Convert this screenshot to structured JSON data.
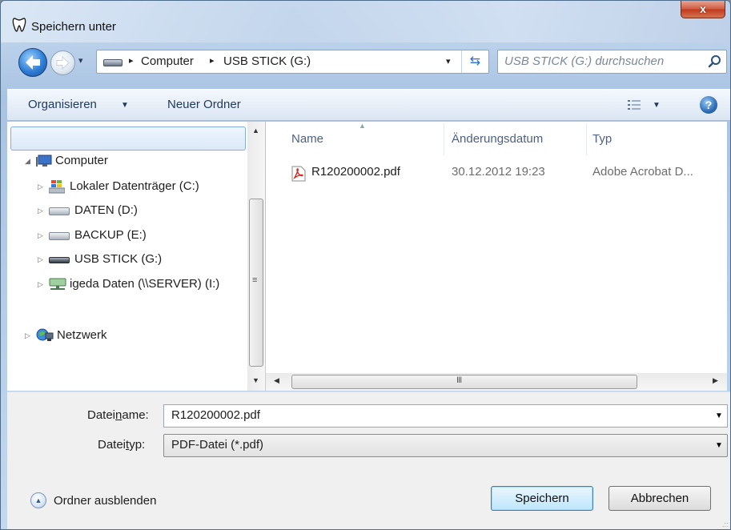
{
  "window": {
    "title": "Speichern unter",
    "close_label": "x"
  },
  "address_bar": {
    "separator": "▸",
    "segments": [
      "Computer",
      "USB STICK (G:)"
    ],
    "dropdown_glyph": "▾",
    "refresh_glyph": "⇆"
  },
  "search": {
    "placeholder": "USB STICK (G:) durchsuchen"
  },
  "toolbar": {
    "organize_label": "Organisieren",
    "dropdown_glyph": "▼",
    "new_folder_label": "Neuer Ordner",
    "help_label": "?"
  },
  "nav_tree": {
    "expander_open": "◢",
    "expander_closed": "▷",
    "items": [
      {
        "label": "Computer",
        "icon": "computer-icon",
        "expanded": true
      },
      {
        "label": "Lokaler Datenträger (C:)",
        "icon": "windows-drive-icon"
      },
      {
        "label": "DATEN (D:)",
        "icon": "drive-icon"
      },
      {
        "label": "BACKUP (E:)",
        "icon": "drive-icon"
      },
      {
        "label": "USB STICK (G:)",
        "icon": "usb-drive-icon",
        "selected": true
      },
      {
        "label": "igeda Daten (\\\\SERVER) (I:)",
        "icon": "network-drive-icon"
      },
      {
        "label": "Netzwerk",
        "icon": "network-icon"
      }
    ]
  },
  "file_list": {
    "columns": [
      "Name",
      "Änderungsdatum",
      "Typ"
    ],
    "rows": [
      {
        "name": "R120200002.pdf",
        "date": "30.12.2012 19:23",
        "type": "Adobe Acrobat D...",
        "icon": "pdf-icon"
      }
    ]
  },
  "scrollbars": {
    "up": "▲",
    "down": "▼",
    "left": "◀",
    "right": "▶",
    "vgrip": "≡",
    "hgrip": "III"
  },
  "form": {
    "filename_label_pre": "Datei",
    "filename_label_accel": "n",
    "filename_label_post": "ame:",
    "filename_value": "R120200002.pdf",
    "filetype_label_pre": "Datei",
    "filetype_label_accel": "t",
    "filetype_label_post": "yp:",
    "filetype_value": "PDF-Datei (*.pdf)",
    "dropdown_glyph": "▼",
    "hide_folders_label": "Ordner ausblenden",
    "hide_folders_glyph": "▲",
    "save_label": "Speichern",
    "cancel_label": "Abbrechen",
    "resize_grip": ".::"
  },
  "colors": {
    "accent": "#2f7fd6",
    "selection_border": "#84acdd",
    "close_red": "#c0381e"
  }
}
